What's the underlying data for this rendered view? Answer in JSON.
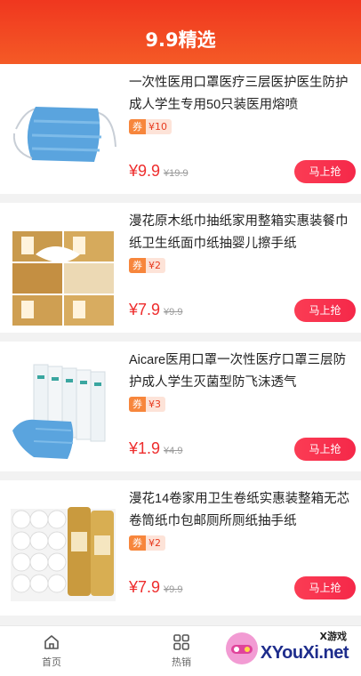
{
  "header": {
    "title": "9.9精选"
  },
  "products": [
    {
      "title": "一次性医用口罩医疗三层医护医生防护成人学生专用50只装医用熔喷",
      "coupon_label": "券",
      "coupon_amount": "¥10",
      "price": "¥9.9",
      "original_price": "¥19.9",
      "buy_label": "马上抢",
      "image": "face-mask-image"
    },
    {
      "title": "漫花原木纸巾抽纸家用整箱实惠装餐巾纸卫生纸面巾纸抽婴儿擦手纸",
      "coupon_label": "券",
      "coupon_amount": "¥2",
      "price": "¥7.9",
      "original_price": "¥9.9",
      "buy_label": "马上抢",
      "image": "tissue-box-image"
    },
    {
      "title": "Aicare医用口罩一次性医疗口罩三层防护成人学生灭菌型防飞沫透气",
      "coupon_label": "券",
      "coupon_amount": "¥3",
      "price": "¥1.9",
      "original_price": "¥4.9",
      "buy_label": "马上抢",
      "image": "mask-packs-image"
    },
    {
      "title": "漫花14卷家用卫生卷纸实惠装整箱无芯卷筒纸巾包邮厕所厕纸抽手纸",
      "coupon_label": "券",
      "coupon_amount": "¥2",
      "price": "¥7.9",
      "original_price": "¥9.9",
      "buy_label": "马上抢",
      "image": "toilet-roll-image"
    }
  ],
  "tabbar": {
    "home": {
      "label": "首页",
      "icon": "home-icon"
    },
    "hot": {
      "label": "热销",
      "icon": "grid-icon"
    }
  },
  "watermark": {
    "small": "X游戏",
    "big": "XYouXi.net"
  }
}
